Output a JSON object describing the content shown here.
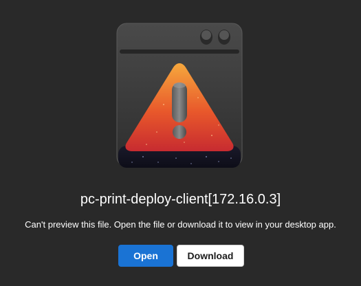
{
  "illustration": {
    "icon": "warning-file-icon",
    "window_color": "#3a3a3a",
    "triangle_gradient": [
      "#f3a03a",
      "#e4542a",
      "#c42a2e"
    ]
  },
  "file": {
    "title": "pc-print-deploy-client[172.16.0.3]"
  },
  "message": "Can't preview this file. Open the file or download it to view in your desktop app.",
  "actions": {
    "open_label": "Open",
    "download_label": "Download",
    "primary_color": "#1a73d4"
  }
}
